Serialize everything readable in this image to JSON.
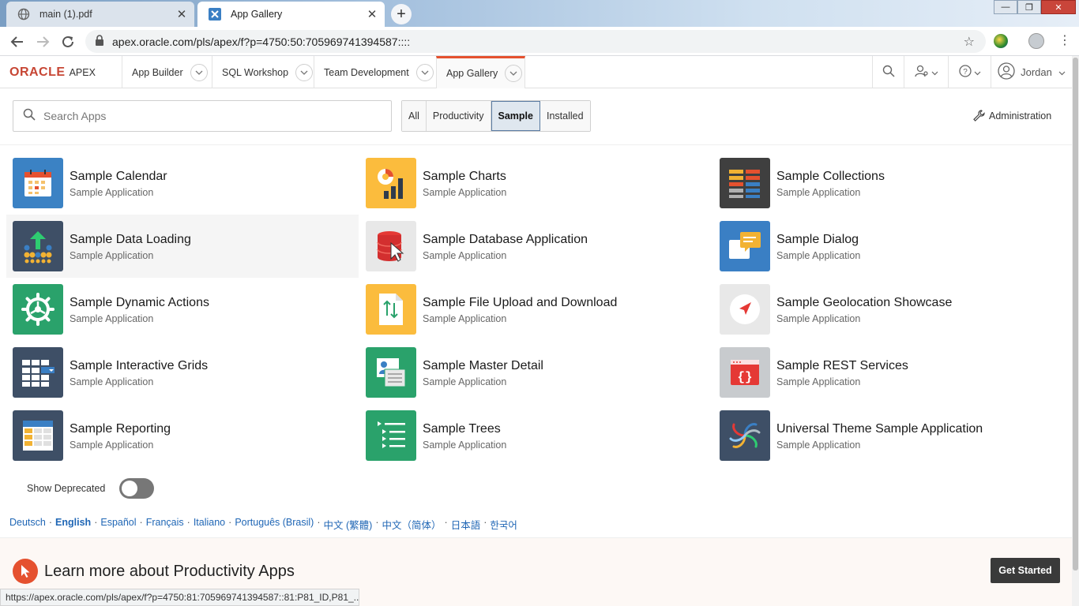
{
  "browser": {
    "tabs": [
      {
        "title": "main (1).pdf",
        "icon": "globe-icon",
        "active": false
      },
      {
        "title": "App Gallery",
        "icon": "apex-favicon-icon",
        "active": true
      }
    ],
    "url": "apex.oracle.com/pls/apex/f?p=4750:50:705969741394587::::",
    "status_url": "https://apex.oracle.com/pls/apex/f?p=4750:81:705969741394587::81:P81_ID,P81_..."
  },
  "header": {
    "brand": "ORACLE",
    "product": "APEX",
    "nav": [
      "App Builder",
      "SQL Workshop",
      "Team Development",
      "App Gallery"
    ],
    "current_nav": "App Gallery",
    "user": "Jordan"
  },
  "search": {
    "placeholder": "Search Apps",
    "value": ""
  },
  "filters": [
    "All",
    "Productivity",
    "Sample",
    "Installed"
  ],
  "selected_filter": "Sample",
  "administration_label": "Administration",
  "apps": [
    {
      "title": "Sample Calendar",
      "subtitle": "Sample Application",
      "icon": "calendar-icon",
      "color": "#3b82c4"
    },
    {
      "title": "Sample Charts",
      "subtitle": "Sample Application",
      "icon": "charts-icon",
      "color": "#fbbc3d"
    },
    {
      "title": "Sample Collections",
      "subtitle": "Sample Application",
      "icon": "collections-icon",
      "color": "#3f3f3f"
    },
    {
      "title": "Sample Data Loading",
      "subtitle": "Sample Application",
      "icon": "data-loading-icon",
      "color": "#3e4f66"
    },
    {
      "title": "Sample Database Application",
      "subtitle": "Sample Application",
      "icon": "database-icon",
      "color": "#e8e8e8"
    },
    {
      "title": "Sample Dialog",
      "subtitle": "Sample Application",
      "icon": "dialog-icon",
      "color": "#3a7fc4"
    },
    {
      "title": "Sample Dynamic Actions",
      "subtitle": "Sample Application",
      "icon": "gear-icon",
      "color": "#2aa26b"
    },
    {
      "title": "Sample File Upload and Download",
      "subtitle": "Sample Application",
      "icon": "file-upload-icon",
      "color": "#fbbc3d"
    },
    {
      "title": "Sample Geolocation Showcase",
      "subtitle": "Sample Application",
      "icon": "geolocation-icon",
      "color": "#e8e8e8"
    },
    {
      "title": "Sample Interactive Grids",
      "subtitle": "Sample Application",
      "icon": "grid-icon",
      "color": "#3e4f66"
    },
    {
      "title": "Sample Master Detail",
      "subtitle": "Sample Application",
      "icon": "master-detail-icon",
      "color": "#2aa26b"
    },
    {
      "title": "Sample REST Services",
      "subtitle": "Sample Application",
      "icon": "rest-icon",
      "color": "#c8cbce"
    },
    {
      "title": "Sample Reporting",
      "subtitle": "Sample Application",
      "icon": "reporting-icon",
      "color": "#3e4f66"
    },
    {
      "title": "Sample Trees",
      "subtitle": "Sample Application",
      "icon": "tree-icon",
      "color": "#2aa26b"
    },
    {
      "title": "Universal Theme Sample Application",
      "subtitle": "Sample Application",
      "icon": "universal-theme-icon",
      "color": "#3e4f66"
    }
  ],
  "show_deprecated": {
    "label": "Show Deprecated",
    "on": false
  },
  "languages": [
    "Deutsch",
    "English",
    "Español",
    "Français",
    "Italiano",
    "Português (Brasil)",
    "中文 (繁體)",
    "中文（简体）",
    "日本語",
    "한국어"
  ],
  "current_language": "English",
  "promo": {
    "title": "Learn more about Productivity Apps",
    "button": "Get Started"
  }
}
